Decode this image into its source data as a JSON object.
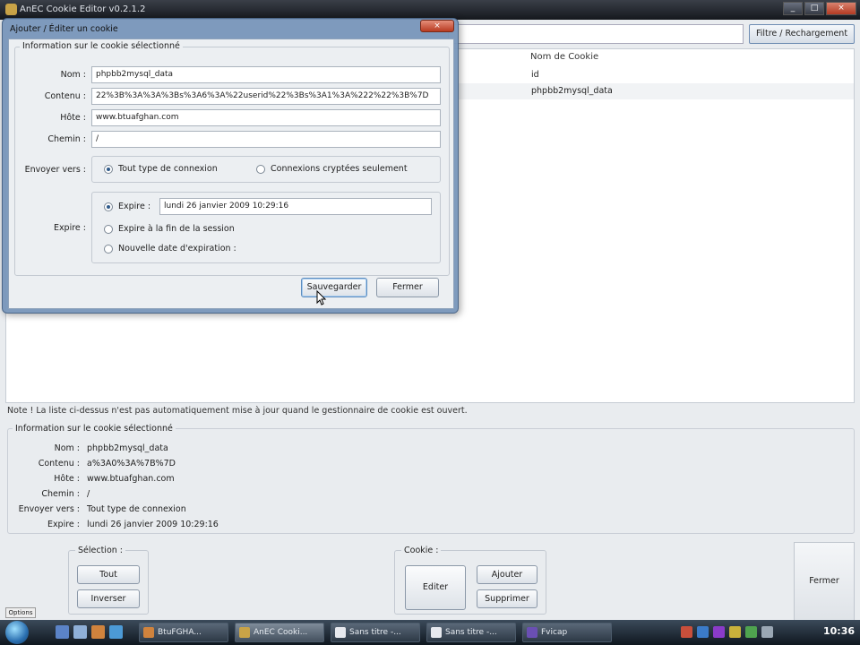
{
  "main_window": {
    "title": "AnEC Cookie Editor v0.2.1.2",
    "filter_button": "Filtre / Rechargement",
    "list_header": "Nom de Cookie",
    "list_rows": [
      "id",
      "phpbb2mysql_data"
    ],
    "note": "Note ! La liste ci-dessus n'est pas automatiquement mise à jour quand le gestionnaire de cookie est ouvert.",
    "info_section": {
      "title": "Information sur le cookie sélectionné",
      "rows": [
        {
          "label": "Nom :",
          "value": "phpbb2mysql_data"
        },
        {
          "label": "Contenu :",
          "value": "a%3A0%3A%7B%7D"
        },
        {
          "label": "Hôte :",
          "value": "www.btuafghan.com"
        },
        {
          "label": "Chemin :",
          "value": "/"
        },
        {
          "label": "Envoyer vers :",
          "value": "Tout type de connexion"
        },
        {
          "label": "Expire :",
          "value": "lundi 26 janvier 2009 10:29:16"
        }
      ]
    },
    "selection": {
      "label": "Sélection :",
      "all": "Tout",
      "invert": "Inverser"
    },
    "cookie": {
      "label": "Cookie :",
      "edit": "Editer",
      "add": "Ajouter",
      "delete": "Supprimer"
    },
    "close": "Fermer",
    "options": "Options"
  },
  "dialog": {
    "title": "Ajouter / Éditer un cookie",
    "close_glyph": "×",
    "group_title": "Information sur le cookie sélectionné",
    "fields": {
      "name_label": "Nom :",
      "name_value": "phpbb2mysql_data",
      "content_label": "Contenu :",
      "content_value": "22%3B%3A%3A%3Bs%3A6%3A%22userid%22%3Bs%3A1%3A%222%22%3B%7D",
      "host_label": "Hôte :",
      "host_value": "www.btuafghan.com",
      "path_label": "Chemin :",
      "path_value": "/"
    },
    "send_to": {
      "label": "Envoyer vers :",
      "option_all": "Tout type de connexion",
      "option_secure": "Connexions cryptées seulement"
    },
    "expire": {
      "label": "Expire :",
      "option_date": "Expire :",
      "date_value": "lundi 26 janvier 2009 10:29:16",
      "option_session": "Expire à la fin de la session",
      "option_new": "Nouvelle date d'expiration :"
    },
    "save_button": "Sauvegarder",
    "close_button": "Fermer"
  },
  "taskbar": {
    "items": [
      "BtuFGHA...",
      "AnEC Cooki...",
      "Sans titre -...",
      "Sans titre -...",
      "Fvicap"
    ],
    "clock": "10:36"
  },
  "window_buttons": {
    "minimize": "_",
    "maximize": "□",
    "close": "×"
  }
}
